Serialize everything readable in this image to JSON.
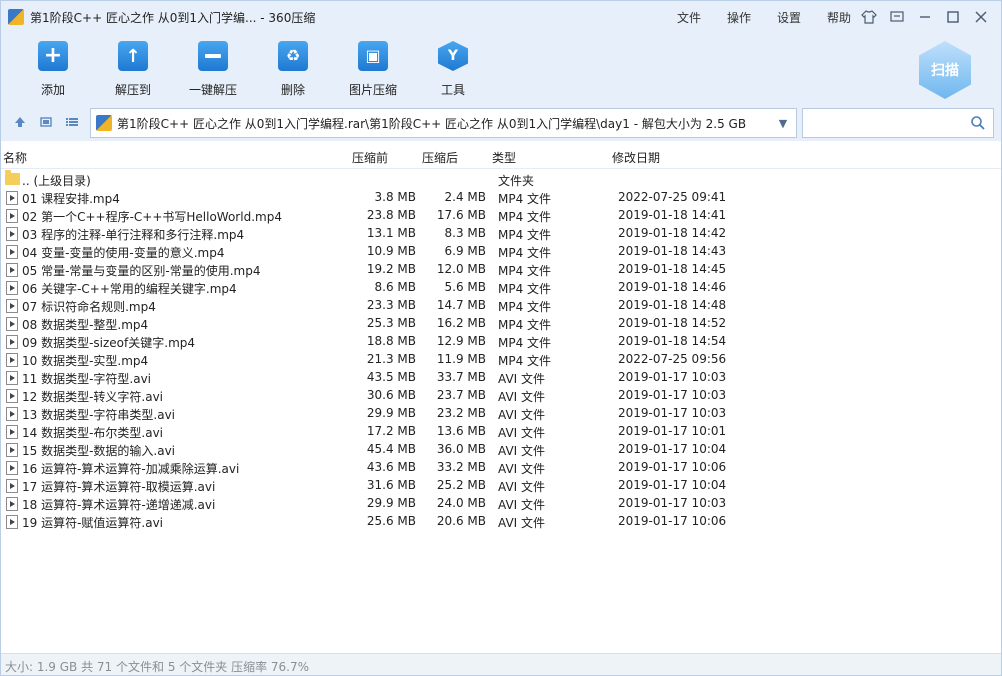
{
  "window": {
    "title": "第1阶段C++ 匠心之作 从0到1入门学编... - 360压缩"
  },
  "menu": [
    "文件",
    "操作",
    "设置",
    "帮助"
  ],
  "toolbar": {
    "items": [
      {
        "label": "添加",
        "icon": "add-icon"
      },
      {
        "label": "解压到",
        "icon": "extract-to-icon"
      },
      {
        "label": "一键解压",
        "icon": "one-click-extract-icon"
      },
      {
        "label": "删除",
        "icon": "delete-icon"
      },
      {
        "label": "图片压缩",
        "icon": "image-compress-icon"
      },
      {
        "label": "工具",
        "icon": "tools-icon"
      }
    ],
    "scan_label": "扫描"
  },
  "address": {
    "path": "第1阶段C++ 匠心之作 从0到1入门学编程.rar\\第1阶段C++ 匠心之作 从0到1入门学编程\\day1 - 解包大小为 2.5 GB",
    "search_placeholder": ""
  },
  "columns": {
    "name": "名称",
    "packed": "压缩前",
    "compressed": "压缩后",
    "type": "类型",
    "modified": "修改日期"
  },
  "parent_row": {
    "name": ".. (上级目录)",
    "type": "文件夹"
  },
  "files": [
    {
      "name": "01 课程安排.mp4",
      "before": "3.8 MB",
      "after": "2.4 MB",
      "type": "MP4 文件",
      "date": "2022-07-25 09:41"
    },
    {
      "name": "02 第一个C++程序-C++书写HelloWorld.mp4",
      "before": "23.8 MB",
      "after": "17.6 MB",
      "type": "MP4 文件",
      "date": "2019-01-18 14:41"
    },
    {
      "name": "03 程序的注释-单行注释和多行注释.mp4",
      "before": "13.1 MB",
      "after": "8.3 MB",
      "type": "MP4 文件",
      "date": "2019-01-18 14:42"
    },
    {
      "name": "04 变量-变量的使用-变量的意义.mp4",
      "before": "10.9 MB",
      "after": "6.9 MB",
      "type": "MP4 文件",
      "date": "2019-01-18 14:43"
    },
    {
      "name": "05 常量-常量与变量的区别-常量的使用.mp4",
      "before": "19.2 MB",
      "after": "12.0 MB",
      "type": "MP4 文件",
      "date": "2019-01-18 14:45"
    },
    {
      "name": "06 关键字-C++常用的编程关键字.mp4",
      "before": "8.6 MB",
      "after": "5.6 MB",
      "type": "MP4 文件",
      "date": "2019-01-18 14:46"
    },
    {
      "name": "07 标识符命名规则.mp4",
      "before": "23.3 MB",
      "after": "14.7 MB",
      "type": "MP4 文件",
      "date": "2019-01-18 14:48"
    },
    {
      "name": "08 数据类型-整型.mp4",
      "before": "25.3 MB",
      "after": "16.2 MB",
      "type": "MP4 文件",
      "date": "2019-01-18 14:52"
    },
    {
      "name": "09 数据类型-sizeof关键字.mp4",
      "before": "18.8 MB",
      "after": "12.9 MB",
      "type": "MP4 文件",
      "date": "2019-01-18 14:54"
    },
    {
      "name": "10 数据类型-实型.mp4",
      "before": "21.3 MB",
      "after": "11.9 MB",
      "type": "MP4 文件",
      "date": "2022-07-25 09:56"
    },
    {
      "name": "11 数据类型-字符型.avi",
      "before": "43.5 MB",
      "after": "33.7 MB",
      "type": "AVI 文件",
      "date": "2019-01-17 10:03"
    },
    {
      "name": "12 数据类型-转义字符.avi",
      "before": "30.6 MB",
      "after": "23.7 MB",
      "type": "AVI 文件",
      "date": "2019-01-17 10:03"
    },
    {
      "name": "13 数据类型-字符串类型.avi",
      "before": "29.9 MB",
      "after": "23.2 MB",
      "type": "AVI 文件",
      "date": "2019-01-17 10:03"
    },
    {
      "name": "14 数据类型-布尔类型.avi",
      "before": "17.2 MB",
      "after": "13.6 MB",
      "type": "AVI 文件",
      "date": "2019-01-17 10:01"
    },
    {
      "name": "15 数据类型-数据的输入.avi",
      "before": "45.4 MB",
      "after": "36.0 MB",
      "type": "AVI 文件",
      "date": "2019-01-17 10:04"
    },
    {
      "name": "16 运算符-算术运算符-加减乘除运算.avi",
      "before": "43.6 MB",
      "after": "33.2 MB",
      "type": "AVI 文件",
      "date": "2019-01-17 10:06"
    },
    {
      "name": "17 运算符-算术运算符-取模运算.avi",
      "before": "31.6 MB",
      "after": "25.2 MB",
      "type": "AVI 文件",
      "date": "2019-01-17 10:04"
    },
    {
      "name": "18 运算符-算术运算符-递增递减.avi",
      "before": "29.9 MB",
      "after": "24.0 MB",
      "type": "AVI 文件",
      "date": "2019-01-17 10:03"
    },
    {
      "name": "19 运算符-赋值运算符.avi",
      "before": "25.6 MB",
      "after": "20.6 MB",
      "type": "AVI 文件",
      "date": "2019-01-17 10:06"
    }
  ],
  "status": {
    "text": "大小: 1.9 GB 共 71 个文件和 5 个文件夹 压缩率 76.7%"
  },
  "colors": {
    "chrome": "#e7f0fa",
    "accent": "#2b86dc",
    "status_text": "#8a8f96"
  }
}
